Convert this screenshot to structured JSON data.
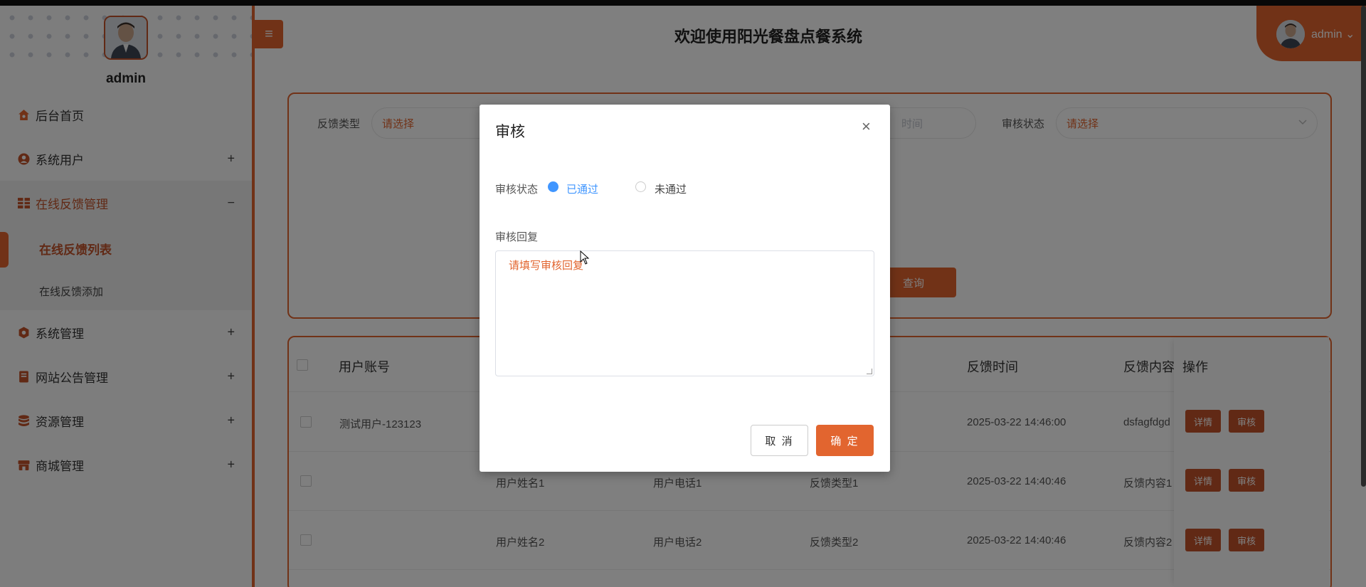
{
  "header": {
    "title": "欢迎使用阳光餐盘点餐系统",
    "user": "admin",
    "user_chevron": "⌄",
    "toggle_glyph": "≡"
  },
  "sidebar": {
    "username": "admin",
    "items": [
      {
        "label": "后台首页",
        "icon": "home-icon"
      },
      {
        "label": "系统用户",
        "icon": "user-circle-icon",
        "toggle": "+"
      },
      {
        "label": "在线反馈管理",
        "icon": "grid-icon",
        "toggle": "−"
      },
      {
        "label": "系统管理",
        "icon": "gear-icon",
        "toggle": "+"
      },
      {
        "label": "网站公告管理",
        "icon": "book-icon",
        "toggle": "+"
      },
      {
        "label": "资源管理",
        "icon": "database-icon",
        "toggle": "+"
      },
      {
        "label": "商城管理",
        "icon": "shop-icon",
        "toggle": "+"
      }
    ],
    "subitems": [
      {
        "label": "在线反馈列表"
      },
      {
        "label": "在线反馈添加"
      }
    ]
  },
  "search": {
    "type_label": "反馈类型",
    "type_placeholder": "请选择",
    "time_placeholder": "时间",
    "status_label": "审核状态",
    "status_placeholder": "请选择",
    "query_label": "查询"
  },
  "table": {
    "headers": [
      "用户账号",
      "反馈时间",
      "反馈内容",
      "操作"
    ],
    "rows": [
      {
        "account": "测试用户-123123",
        "name": "",
        "phone": "",
        "type": "",
        "time": "2025-03-22 14:46:00",
        "content": "dsfagfdgd"
      },
      {
        "account": "",
        "name": "用户姓名1",
        "phone": "用户电话1",
        "type": "反馈类型1",
        "time": "2025-03-22 14:40:46",
        "content": "反馈内容1"
      },
      {
        "account": "",
        "name": "用户姓名2",
        "phone": "用户电话2",
        "type": "反馈类型2",
        "time": "2025-03-22 14:40:46",
        "content": "反馈内容2"
      }
    ],
    "detail_label": "详情",
    "audit_label": "审核"
  },
  "dialog": {
    "title": "审核",
    "close_glyph": "×",
    "status_label": "审核状态",
    "option_pass": "已通过",
    "option_fail": "未通过",
    "selected": "已通过",
    "reply_label": "审核回复",
    "reply_placeholder": "请填写审核回复",
    "cancel_label": "取 消",
    "ok_label": "确 定"
  },
  "colors": {
    "accent": "#e2652f",
    "accent_dark": "#c2532a",
    "radio_selected": "#4096ff"
  }
}
